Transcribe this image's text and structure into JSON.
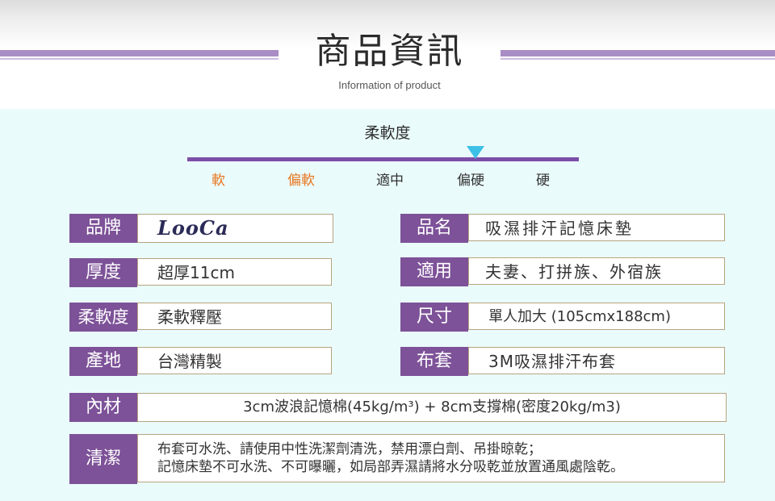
{
  "header": {
    "title": "商品資訊",
    "subtitle": "Information of product"
  },
  "softness": {
    "title": "柔軟度",
    "scale": [
      "軟",
      "偏軟",
      "適中",
      "偏硬",
      "硬"
    ],
    "selected": "偏硬",
    "colors": {
      "bar": "#7c4ea8",
      "marker": "#3cc0e6",
      "soft_labels": "#e8761f"
    }
  },
  "specs": {
    "brand": {
      "label": "品牌",
      "value": "LooCa"
    },
    "name": {
      "label": "品名",
      "value": "吸濕排汗記憶床墊"
    },
    "thickness": {
      "label": "厚度",
      "value": "超厚11cm"
    },
    "usage": {
      "label": "適用",
      "value": "夫妻、打拼族、外宿族"
    },
    "softness": {
      "label": "柔軟度",
      "value": "柔軟釋壓"
    },
    "size": {
      "label": "尺寸",
      "value": "單人加大 (105cmx188cm)"
    },
    "origin": {
      "label": "產地",
      "value": "台灣精製"
    },
    "cover": {
      "label": "布套",
      "value": "3M吸濕排汗布套"
    },
    "material": {
      "label": "內材",
      "value": "3cm波浪記憶棉(45kg/m³) + 8cm支撐棉(密度20kg/m3)"
    },
    "washing": {
      "label": "清潔",
      "lines": [
        "布套可水洗、請使用中性洗潔劑清洗，禁用漂白劑、吊掛晾乾；",
        "記憶床墊不可水洗、不可曝曬，如局部弄濕請將水分吸乾並放置通風處陰乾。"
      ]
    }
  },
  "theme": {
    "label_bg": "#7d5298",
    "panel_bg": "#eafbfb",
    "box_border": "#b7a47f"
  }
}
